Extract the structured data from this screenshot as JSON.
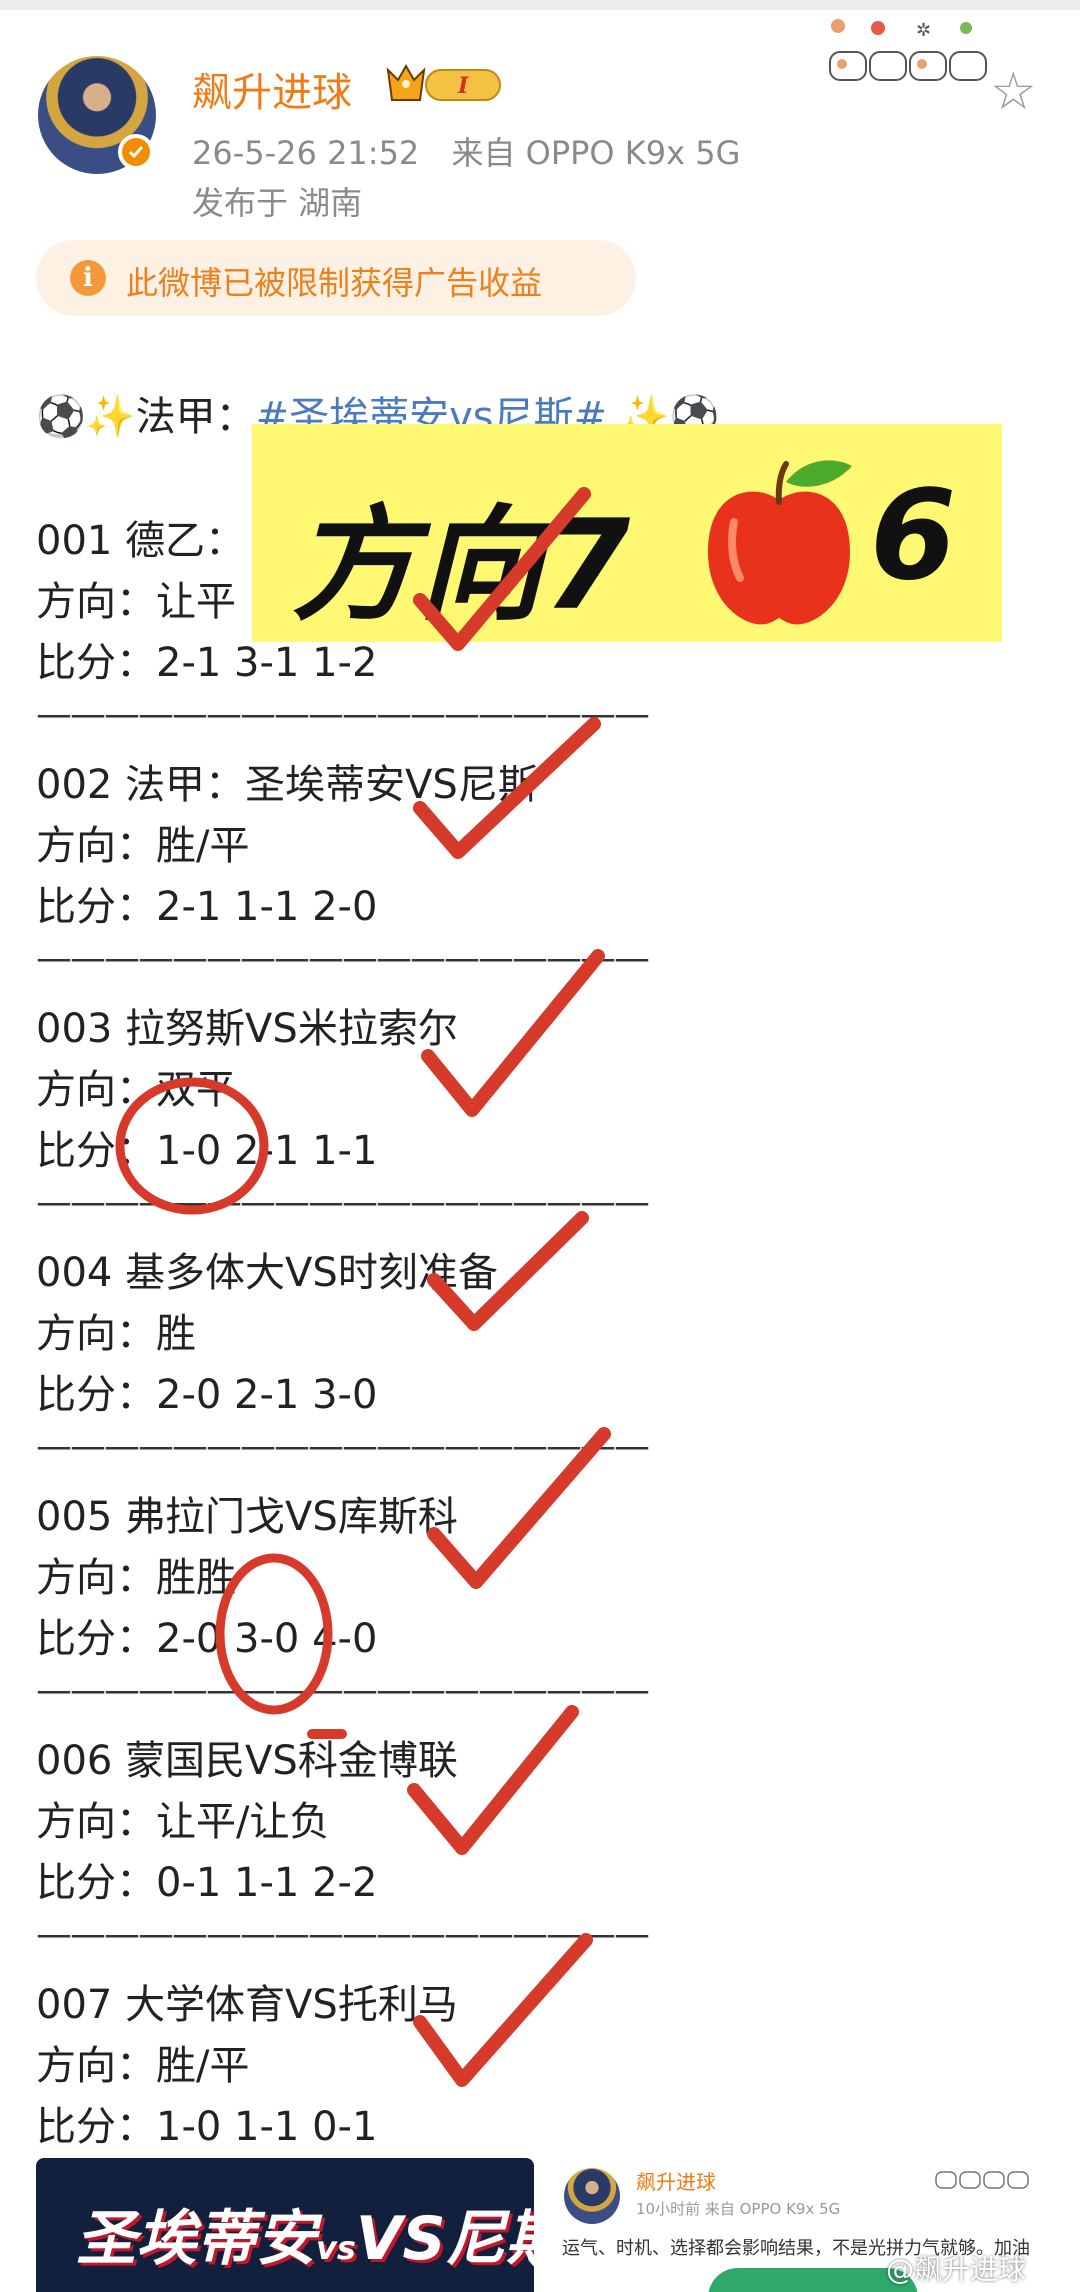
{
  "header": {
    "username": "飙升进球",
    "level_badge": "I",
    "time": "26-5-26 21:52",
    "source": "来自 OPPO K9x 5G",
    "location": "发布于 湖南"
  },
  "notice": {
    "icon_char": "i",
    "text": "此微博已被限制获得广告收益"
  },
  "post": {
    "title_prefix": "⚽✨法甲：",
    "hashtag": "#圣埃蒂安vs尼斯#",
    "title_suffix": " ✨⚽",
    "separator": "——————————————————",
    "entries": [
      {
        "match": "001 德乙：",
        "direction": "方向：让平",
        "score": "比分：2-1 3-1 1-2"
      },
      {
        "match": "002 法甲：圣埃蒂安VS尼斯",
        "direction": "方向：胜/平",
        "score": "比分：2-1 1-1 2-0"
      },
      {
        "match": "003 拉努斯VS米拉索尔",
        "direction": "方向：双平",
        "score": "比分：1-0 2-1 1-1"
      },
      {
        "match": "004 基多体大VS时刻准备",
        "direction": "方向：胜",
        "score": "比分：2-0 2-1 3-0"
      },
      {
        "match": "005 弗拉门戈VS库斯科",
        "direction": "方向：胜胜",
        "score": "比分：2-0 3-0 4-0"
      },
      {
        "match": "006 蒙国民VS科金博联",
        "direction": "方向：让平/让负",
        "score": "比分：0-1 1-1 2-2"
      },
      {
        "match": "007 大学体育VS托利马",
        "direction": "方向：胜/平",
        "score": "比分：1-0 1-1 0-1"
      }
    ]
  },
  "banner": {
    "text": "方向7",
    "number": "6",
    "apple_icon": "apple-icon"
  },
  "bottom": {
    "left_card_title_a": "圣埃蒂安",
    "left_card_vs": "vs",
    "left_card_title_b": "VS尼斯",
    "right_card_name": "飙升进球",
    "right_card_meta": "10小时前  来自 OPPO K9x 5G",
    "right_card_text": "运气、时机、选择都会影响结果，不是光拼力气就够。加油",
    "watermark": "@飙升进球"
  },
  "colors": {
    "accent_orange": "#f07b14",
    "hashtag_blue": "#4a7bbf",
    "banner_yellow": "#fef872",
    "mark_red": "#d63a2a"
  }
}
